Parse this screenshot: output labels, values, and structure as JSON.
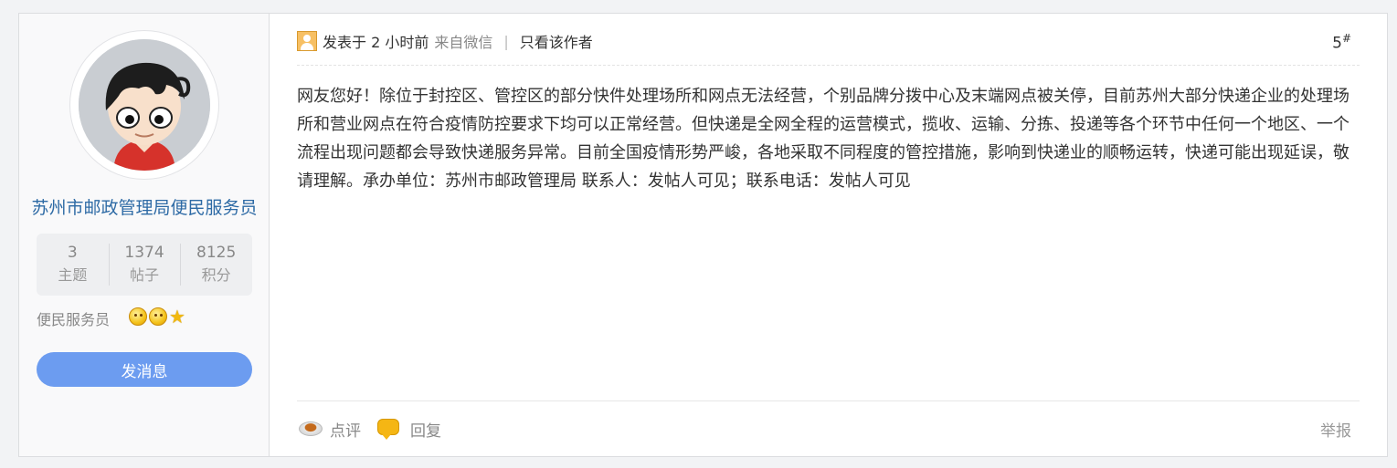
{
  "user": {
    "name": "苏州市邮政管理局便民服务员",
    "stats": [
      {
        "num": "3",
        "label": "主题"
      },
      {
        "num": "1374",
        "label": "帖子"
      },
      {
        "num": "8125",
        "label": "积分"
      }
    ],
    "rank": "便民服务员",
    "message_button": "发消息"
  },
  "post": {
    "posted": "发表于 2 小时前",
    "source": "来自微信",
    "separator": "|",
    "only_author": "只看该作者",
    "floor_num": "5",
    "floor_mark": "#",
    "content": "网友您好！除位于封控区、管控区的部分快件处理场所和网点无法经营，个别品牌分拨中心及末端网点被关停，目前苏州大部分快递企业的处理场所和营业网点在符合疫情防控要求下均可以正常经营。但快递是全网全程的运营模式，揽收、运输、分拣、投递等各个环节中任何一个地区、一个流程出现问题都会导致快递服务异常。目前全国疫情形势严峻，各地采取不同程度的管控措施，影响到快递业的顺畅运转，快递可能出现延误，敬请理解。承办单位：苏州市邮政管理局 联系人：发帖人可见；联系电话：发帖人可见"
  },
  "actions": {
    "comment": "点评",
    "reply": "回复",
    "report": "举报"
  },
  "icons": {
    "avatar": "cartoon-avatar",
    "user": "user-icon",
    "comment": "coffee-cup-icon",
    "reply": "speech-bubble-icon",
    "rank_badges": [
      "smiley-badge-icon",
      "smiley-badge-icon",
      "star-badge-icon"
    ]
  },
  "colors": {
    "username": "#2d6aa5",
    "button": "#6c9cf0"
  }
}
